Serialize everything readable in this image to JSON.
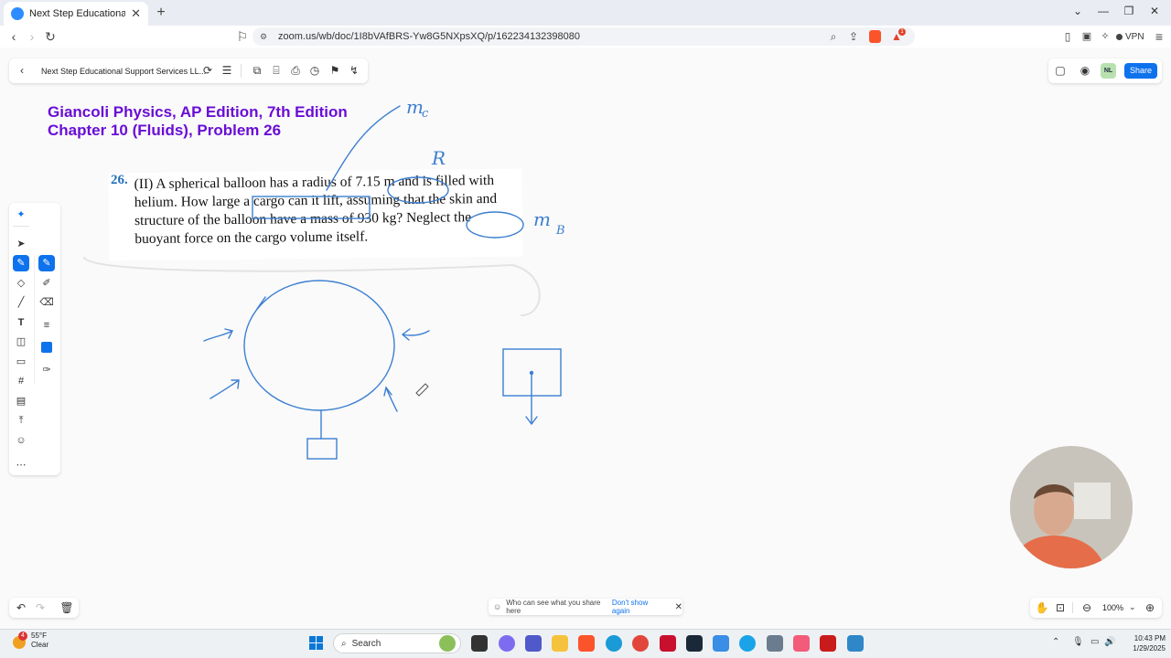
{
  "browser": {
    "tab_title": "Next Step Educational Support",
    "tab_close": "✕",
    "new_tab": "+",
    "url": "zoom.us/wb/doc/1I8bVAfBRS-Yw8G5NXpsXQ/p/162234132398080",
    "vpn_label": "VPN",
    "brave_badge": "1"
  },
  "whiteboard_toolbar": {
    "back_icon": "‹",
    "doc_title": "Next Step Educational Support Services LL...",
    "share_label": "Share",
    "user_initials": "NL"
  },
  "titles": {
    "line1": "Giancoli Physics, AP Edition, 7th Edition",
    "line2": "Chapter 10 (Fluids), Problem 26"
  },
  "problem": {
    "number": "26.",
    "text": "(II) A spherical balloon has a radius of 7.15 m and is filled with helium. How large a cargo can it lift, assuming that the skin and structure of the balloon have a mass of 930 kg? Neglect the buoyant force on the cargo volume itself."
  },
  "annotations": {
    "mc": "m",
    "mc_sub": "c",
    "r": "R",
    "mb": "m",
    "mb_sub": "B"
  },
  "notice": {
    "text": "Who can see what you share here",
    "link": "Don't show again"
  },
  "zoom_level": "100%",
  "taskbar": {
    "weather_temp": "55°F",
    "weather_cond": "Clear",
    "weather_badge": "4",
    "search_label": "Search",
    "time": "10:43 PM",
    "date": "1/29/2025"
  },
  "colors": {
    "ink": "#3b7fd1",
    "title": "#6a0dd6",
    "accent": "#0e72ed"
  }
}
